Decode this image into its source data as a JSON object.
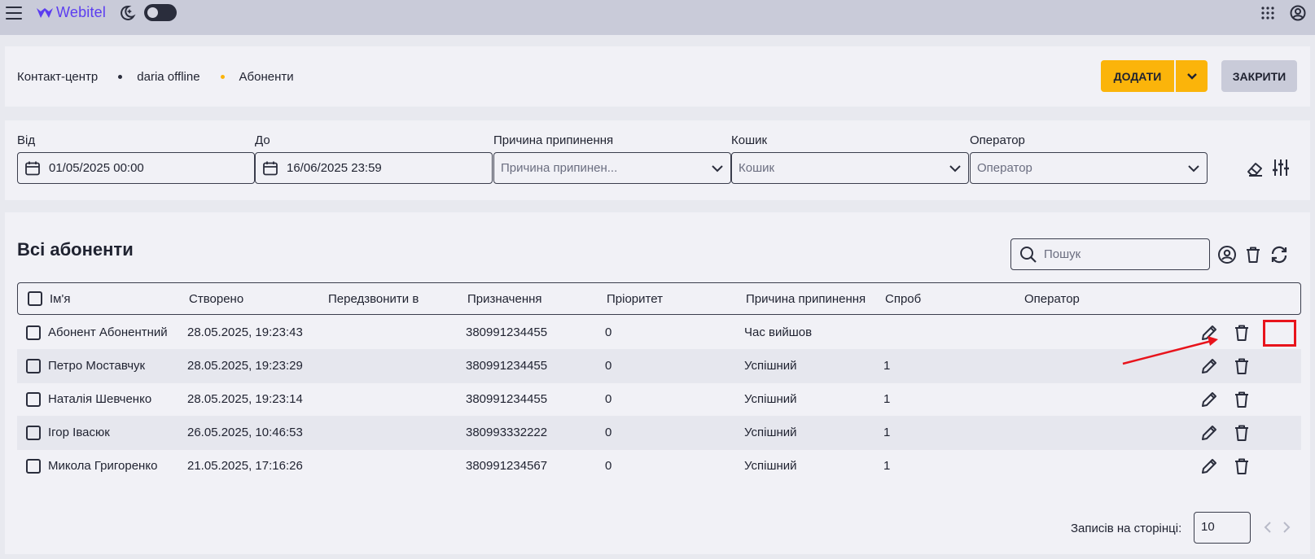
{
  "topbar": {
    "brand": "Webitel",
    "accent": "#5b3df0"
  },
  "header": {
    "breadcrumbs": [
      "Контакт-центр",
      "daria offline",
      "Абоненти"
    ],
    "breadcrumb_dot_colors": [
      "#2a2d3c",
      "#fbb40a"
    ],
    "add_label": "ДОДАТИ",
    "close_label": "ЗАКРИТИ",
    "accent": "#fbb40a"
  },
  "filters": {
    "from": {
      "label": "Від",
      "value": "01/05/2025 00:00"
    },
    "to": {
      "label": "До",
      "value": "16/06/2025 23:59"
    },
    "reason": {
      "label": "Причина припинення",
      "placeholder": "Причина припинен..."
    },
    "bucket": {
      "label": "Кошик",
      "placeholder": "Кошик"
    },
    "operator": {
      "label": "Оператор",
      "placeholder": "Оператор"
    }
  },
  "table": {
    "title": "Всі абоненти",
    "search_placeholder": "Пошук",
    "columns": [
      "Ім'я",
      "Створено",
      "Передзвонити в",
      "Призначення",
      "Пріоритет",
      "Причина припинення",
      "Спроб",
      "Оператор"
    ],
    "rows": [
      {
        "name": "Абонент Абонентний",
        "created": "28.05.2025, 19:23:43",
        "callback": "",
        "destination": "380991234455",
        "priority": "0",
        "reason": "Час вийшов",
        "attempts": "",
        "operator": ""
      },
      {
        "name": "Петро Моставчук",
        "created": "28.05.2025, 19:23:29",
        "callback": "",
        "destination": "380991234455",
        "priority": "0",
        "reason": "Успішний",
        "attempts": "1",
        "operator": ""
      },
      {
        "name": "Наталія Шевченко",
        "created": "28.05.2025, 19:23:14",
        "callback": "",
        "destination": "380991234455",
        "priority": "0",
        "reason": "Успішний",
        "attempts": "1",
        "operator": ""
      },
      {
        "name": "Ігор Івасюк",
        "created": "26.05.2025, 10:46:53",
        "callback": "",
        "destination": "380993332222",
        "priority": "0",
        "reason": "Успішний",
        "attempts": "1",
        "operator": ""
      },
      {
        "name": "Микола Григоренко",
        "created": "21.05.2025, 17:16:26",
        "callback": "",
        "destination": "380991234567",
        "priority": "0",
        "reason": "Успішний",
        "attempts": "1",
        "operator": ""
      }
    ],
    "highlight_color": "#e8141c"
  },
  "pagination": {
    "label": "Записів на сторінці:",
    "per_page": "10"
  }
}
